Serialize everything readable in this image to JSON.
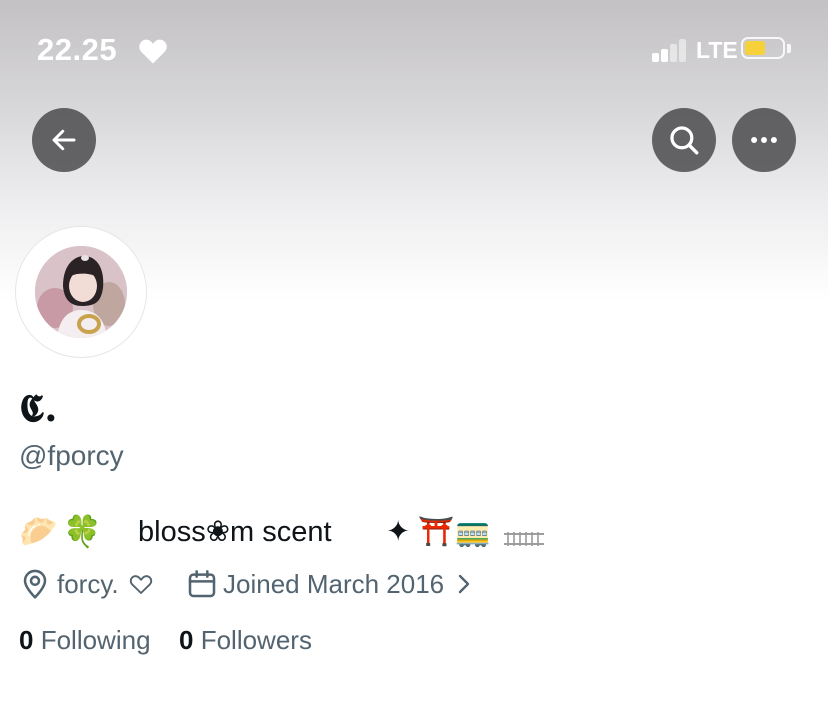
{
  "status_bar": {
    "time": "22.25",
    "network": "LTE",
    "battery_level": 0.55,
    "battery_color": "#f7d13a",
    "signal_bars_active": 2,
    "signal_bars_total": 4
  },
  "header": {
    "back_icon": "arrow-left-icon",
    "search_icon": "search-icon",
    "more_icon": "more-horizontal-icon"
  },
  "profile": {
    "display_name": "𝕮.",
    "handle": "@fporcy",
    "bio": {
      "leading_emoji": "🥟",
      "clover_emoji": "🍀",
      "text": "bloss❀m scent",
      "trailing_symbols": "✦ ⛩️🚃"
    },
    "location": "forcy.",
    "joined": "Joined March 2016",
    "following_count": "0",
    "following_label": "Following",
    "followers_count": "0",
    "followers_label": "Followers"
  },
  "colors": {
    "secondary_text": "#536471",
    "primary_text": "#0f1419",
    "button_bg": "#464648"
  }
}
